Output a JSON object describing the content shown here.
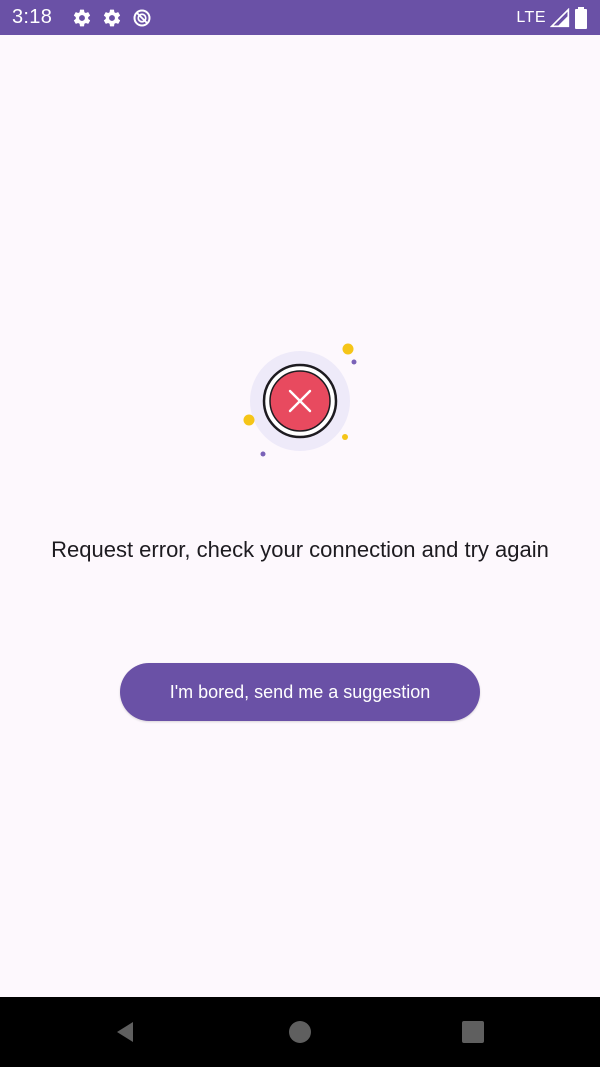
{
  "status_bar": {
    "time": "3:18",
    "network": "LTE",
    "icons": [
      "settings-icon",
      "settings-icon",
      "data-saver-icon",
      "signal-icon",
      "battery-icon"
    ]
  },
  "error": {
    "message": "Request error, check your connection and try again",
    "icon": "error-x-icon"
  },
  "action": {
    "suggestion_button_label": "I'm bored, send me a suggestion"
  },
  "nav_bar": {
    "buttons": [
      "back-icon",
      "home-icon",
      "recents-icon"
    ]
  },
  "colors": {
    "primary": "#6a51a6",
    "background": "#fdf8fd",
    "error_red": "#e84a5f",
    "accent_yellow": "#f5c518"
  }
}
